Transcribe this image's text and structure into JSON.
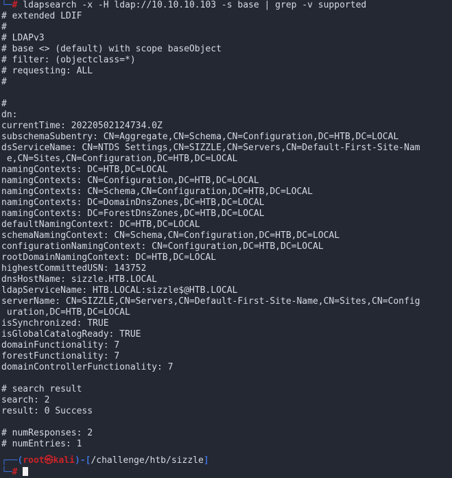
{
  "terminal": {
    "colors": {
      "background": "#242832",
      "foreground": "#d6dae3",
      "prompt_blue": "#3b6fd4",
      "prompt_red": "#cc2229",
      "cursor": "#f2f2f2"
    },
    "command": {
      "prefix_bracket": "└─",
      "prefix_hash": "#",
      "text": " ldapsearch -x -H ldap://10.10.10.103 -s base | grep -v supported"
    },
    "output_lines": [
      "# extended LDIF",
      "#",
      "# LDAPv3",
      "# base <> (default) with scope baseObject",
      "# filter: (objectclass=*)",
      "# requesting: ALL",
      "#",
      "",
      "#",
      "dn:",
      "currentTime: 20220502124734.0Z",
      "subschemaSubentry: CN=Aggregate,CN=Schema,CN=Configuration,DC=HTB,DC=LOCAL",
      "dsServiceName: CN=NTDS Settings,CN=SIZZLE,CN=Servers,CN=Default-First-Site-Nam",
      " e,CN=Sites,CN=Configuration,DC=HTB,DC=LOCAL",
      "namingContexts: DC=HTB,DC=LOCAL",
      "namingContexts: CN=Configuration,DC=HTB,DC=LOCAL",
      "namingContexts: CN=Schema,CN=Configuration,DC=HTB,DC=LOCAL",
      "namingContexts: DC=DomainDnsZones,DC=HTB,DC=LOCAL",
      "namingContexts: DC=ForestDnsZones,DC=HTB,DC=LOCAL",
      "defaultNamingContext: DC=HTB,DC=LOCAL",
      "schemaNamingContext: CN=Schema,CN=Configuration,DC=HTB,DC=LOCAL",
      "configurationNamingContext: CN=Configuration,DC=HTB,DC=LOCAL",
      "rootDomainNamingContext: DC=HTB,DC=LOCAL",
      "highestCommittedUSN: 143752",
      "dnsHostName: sizzle.HTB.LOCAL",
      "ldapServiceName: HTB.LOCAL:sizzle$@HTB.LOCAL",
      "serverName: CN=SIZZLE,CN=Servers,CN=Default-First-Site-Name,CN=Sites,CN=Config",
      " uration,DC=HTB,DC=LOCAL",
      "isSynchronized: TRUE",
      "isGlobalCatalogReady: TRUE",
      "domainFunctionality: 7",
      "forestFunctionality: 7",
      "domainControllerFunctionality: 7",
      "",
      "# search result",
      "search: 2",
      "result: 0 Success",
      "",
      "# numResponses: 2",
      "# numEntries: 1"
    ],
    "prompt": {
      "top_corner": "┌──",
      "open_paren": "(",
      "user": "root",
      "kali_icon": "㉿",
      "host": "kali",
      "close_paren": ")",
      "dash": "-",
      "open_bracket": "[",
      "path": "/challenge/htb/sizzle",
      "close_bracket": "]",
      "bottom_corner": "└─",
      "hash": "#"
    }
  }
}
